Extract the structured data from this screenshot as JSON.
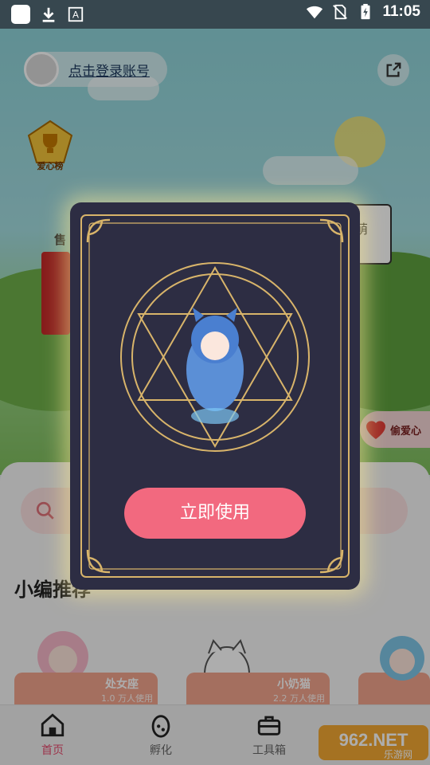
{
  "status_bar": {
    "time": "11:05",
    "left_icons": [
      "app-square-icon",
      "download-icon",
      "font-a-icon"
    ],
    "right_icons": [
      "wifi-icon",
      "no-sim-icon",
      "battery-charging-icon"
    ]
  },
  "header": {
    "login_text": "点击登录账号",
    "share_icon": "share-icon"
  },
  "scene": {
    "rank_label": "爱心榜",
    "stall_sign": "售",
    "speech_text": "萌",
    "steal_label": "偷爱心"
  },
  "search": {
    "icon": "search-icon"
  },
  "section": {
    "title": "小编推荐"
  },
  "cards": [
    {
      "name": "处女座",
      "users": "1.0 万人使用"
    },
    {
      "name": "小奶猫",
      "users": "2.2 万人使用"
    }
  ],
  "bottom_nav": {
    "items": [
      {
        "label": "首页",
        "icon": "home-icon",
        "active": true
      },
      {
        "label": "孵化",
        "icon": "egg-icon",
        "active": false
      },
      {
        "label": "工具箱",
        "icon": "toolbox-icon",
        "active": false
      }
    ]
  },
  "modal": {
    "button_label": "立即使用"
  },
  "watermark": {
    "text": "962.NET",
    "subtext": "乐游网"
  },
  "colors": {
    "accent_pink": "#f2697f",
    "modal_bg": "#2d2d43",
    "gold": "#d8b46a"
  }
}
